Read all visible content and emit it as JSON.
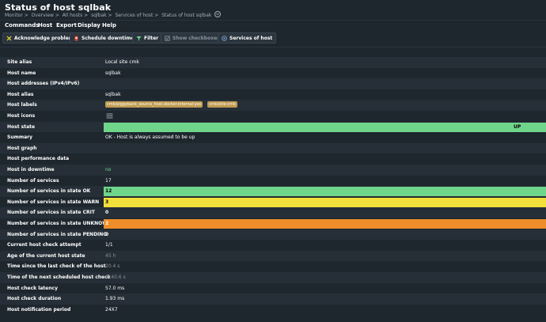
{
  "header": {
    "title": "Status of host sqlbak",
    "breadcrumb": [
      "Monitor >",
      "Overview >",
      "All hosts >",
      "sqlbak >",
      "Services of host >",
      "Status of host sqlbak"
    ]
  },
  "menu": [
    "Commands",
    "Host",
    "Export",
    "Display",
    "Help"
  ],
  "toolbar": {
    "acknowledge": "Acknowledge problems",
    "schedule": "Schedule downtimes",
    "filter": "Filter",
    "checkboxes": "Show checkboxes",
    "services": "Services of host"
  },
  "colors": {
    "ok": "#6fd58b",
    "warn": "#f3df3b",
    "unknown": "#ee8e2a",
    "tag": "#c09b51",
    "background": "#1e262e"
  },
  "rows": {
    "site_alias": {
      "label": "Site alias",
      "value": "Local site cmk"
    },
    "host_name": {
      "label": "Host name",
      "value": "sqlbak"
    },
    "host_addresses": {
      "label": "Host addresses (IPv4/IPv6)",
      "value": ""
    },
    "host_alias": {
      "label": "Host alias",
      "value": "sqlbak"
    },
    "host_labels": {
      "label": "Host labels",
      "tags": [
        "cmk/piggyback_source_host.docker.internal:yes",
        "cmk/site:cmk"
      ]
    },
    "host_icons": {
      "label": "Host icons",
      "icon": "menu-icon"
    },
    "host_state": {
      "label": "Host state",
      "value": "UP"
    },
    "summary": {
      "label": "Summary",
      "value": "OK - Host is always assumed to be up"
    },
    "host_graph": {
      "label": "Host graph",
      "value": ""
    },
    "host_perf": {
      "label": "Host performance data",
      "value": ""
    },
    "host_downtime": {
      "label": "Host in downtime",
      "value": "no"
    },
    "num_services": {
      "label": "Number of services",
      "value": "17"
    },
    "num_ok": {
      "label": "Number of services in state OK",
      "value": "12"
    },
    "num_warn": {
      "label": "Number of services in state WARN",
      "value": "3"
    },
    "num_crit": {
      "label": "Number of services in state CRIT",
      "value": "0"
    },
    "num_unknown": {
      "label": "Number of services in state UNKNOWN",
      "value": "2"
    },
    "num_pending": {
      "label": "Number of services in state PENDING",
      "value": "0"
    },
    "check_attempt": {
      "label": "Current host check attempt",
      "value": "1/1"
    },
    "age_state": {
      "label": "Age of the current host state",
      "value": "45 h"
    },
    "since_last_check": {
      "label": "Time since the last check of the host",
      "value": "20.4 s"
    },
    "next_check": {
      "label": "Time of the next scheduled host check",
      "value": "in 40.6 s"
    },
    "check_latency": {
      "label": "Host check latency",
      "value": "57.0 ms"
    },
    "check_duration": {
      "label": "Host check duration",
      "value": "1.93 ms"
    },
    "notification_period": {
      "label": "Host notification period",
      "value": "24X7"
    }
  }
}
